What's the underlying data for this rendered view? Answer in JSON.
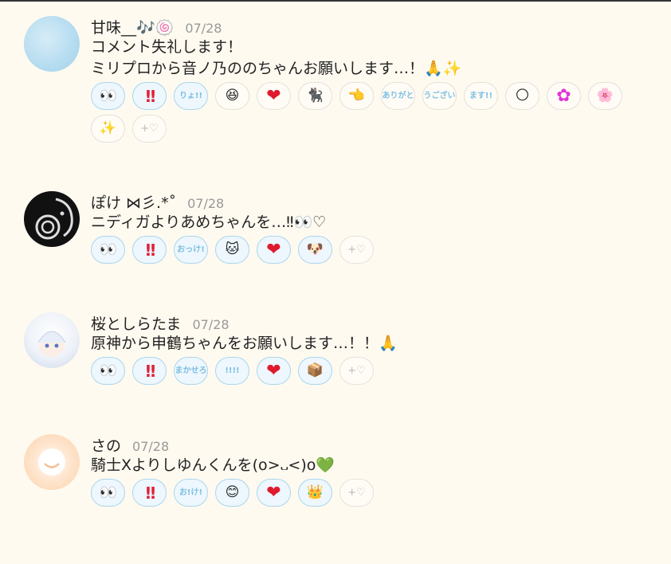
{
  "comments": [
    {
      "username": "甘味__🎶🍥",
      "date": "07/28",
      "lines": [
        "コメント失礼します！",
        "ミリプロから音ノ乃ののちゃんお願いします…！🙏✨"
      ],
      "reactions": [
        {
          "label": "👀",
          "icon": "eyes-icon"
        },
        {
          "label": "!!",
          "icon": "double-exclamation-icon"
        },
        {
          "label": "りょ!!",
          "icon": "ryo-text-icon"
        },
        {
          "label": "😆",
          "icon": "grin-face-icon"
        },
        {
          "label": "❤",
          "icon": "heart-icon"
        },
        {
          "label": "🐈‍⬛",
          "icon": "black-cat-icon"
        },
        {
          "label": "👈",
          "icon": "pointing-hand-icon"
        },
        {
          "label": "ありがと",
          "icon": "arigato-text-icon"
        },
        {
          "label": "うござい",
          "icon": "gozai-text-icon"
        },
        {
          "label": "ます!!",
          "icon": "masu-text-icon"
        },
        {
          "label": "🌕",
          "icon": "moon-icon"
        },
        {
          "label": "✿",
          "icon": "pink-flower-icon"
        },
        {
          "label": "🌸",
          "icon": "sticker-icon"
        },
        {
          "label": "✨",
          "icon": "sparkles-icon"
        }
      ],
      "add_label": "+♡"
    },
    {
      "username": "ぽけ ⋈彡.*˚",
      "date": "07/28",
      "lines": [
        "ニディガよりあめちゃんを…‼︎👀♡"
      ],
      "reactions": [
        {
          "label": "👀",
          "icon": "eyes-icon"
        },
        {
          "label": "!!",
          "icon": "double-exclamation-icon"
        },
        {
          "label": "おっけ!",
          "icon": "okke-text-icon"
        },
        {
          "label": "🐱",
          "icon": "cat-face-icon"
        },
        {
          "label": "❤",
          "icon": "heart-icon"
        },
        {
          "label": "🐶",
          "icon": "dog-photo-icon"
        }
      ],
      "add_label": "+♡"
    },
    {
      "username": "桜としらたま",
      "date": "07/28",
      "lines": [
        "原神から申鶴ちゃんをお願いします…！！🙏"
      ],
      "reactions": [
        {
          "label": "👀",
          "icon": "eyes-icon"
        },
        {
          "label": "!!",
          "icon": "double-exclamation-icon"
        },
        {
          "label": "まかせろ",
          "icon": "makasero-text-icon"
        },
        {
          "label": "!!!!",
          "icon": "exclamations-text-icon"
        },
        {
          "label": "❤",
          "icon": "heart-icon"
        },
        {
          "label": "📦",
          "icon": "box-photo-icon"
        }
      ],
      "add_label": "+♡"
    },
    {
      "username": "さの",
      "date": "07/28",
      "lines": [
        "騎士Xよりしゆんくんを(o>᎑<)o💚"
      ],
      "reactions": [
        {
          "label": "👀",
          "icon": "eyes-icon"
        },
        {
          "label": "!!",
          "icon": "double-exclamation-icon"
        },
        {
          "label": "お!け!",
          "icon": "oke-text-icon"
        },
        {
          "label": "😊",
          "icon": "smile-face-icon"
        },
        {
          "label": "❤",
          "icon": "heart-icon"
        },
        {
          "label": "👑",
          "icon": "crown-character-icon"
        }
      ],
      "add_label": "+♡"
    }
  ]
}
